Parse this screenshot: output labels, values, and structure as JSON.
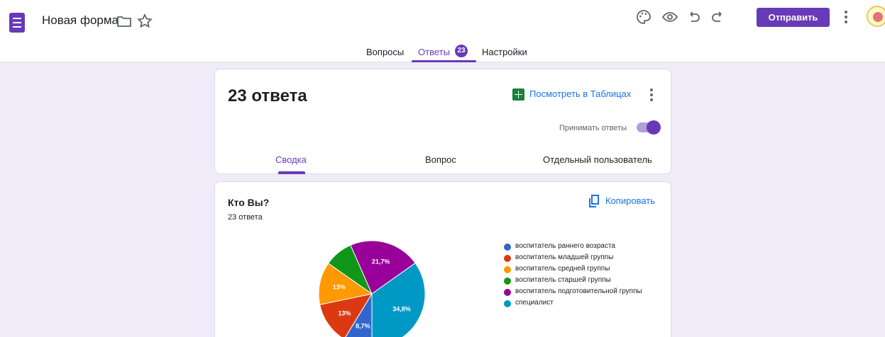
{
  "header": {
    "title": "Новая форма",
    "send_label": "Отправить"
  },
  "tabs": {
    "questions": "Вопросы",
    "responses": "Ответы",
    "responses_count": "23",
    "settings": "Настройки"
  },
  "summary_card": {
    "response_count": "23 ответа",
    "sheets_link": "Посмотреть в Таблицах",
    "accept_label": "Принимать ответы",
    "accepting_responses": true,
    "views": {
      "summary": "Сводка",
      "question": "Вопрос",
      "individual": "Отдельный пользователь"
    }
  },
  "question_card": {
    "title": "Кто Вы?",
    "response_count": "23 ответа",
    "copy_label": "Копировать"
  },
  "chart_data": {
    "type": "pie",
    "title": "",
    "slices": [
      {
        "label": "воспитатель раннего возраста",
        "value": 8.7,
        "display": "8,7%",
        "color": "#3366cc"
      },
      {
        "label": "воспитатель младшей группы",
        "value": 13.0,
        "display": "13%",
        "color": "#dc3912"
      },
      {
        "label": "воспитатель средней группы",
        "value": 13.0,
        "display": "13%",
        "color": "#ff9900"
      },
      {
        "label": "воспитатель старшей группы",
        "value": 8.7,
        "display": "",
        "color": "#109618"
      },
      {
        "label": "воспитатель подготовительной группы",
        "value": 21.7,
        "display": "21,7%",
        "color": "#990099"
      },
      {
        "label": "специалист",
        "value": 34.8,
        "display": "34,8%",
        "color": "#0099c6"
      }
    ],
    "legend_position": "right"
  },
  "colors": {
    "accent": "#673ab7",
    "link": "#1a73e8",
    "background": "#f0ebf8",
    "sheets": "#188038"
  },
  "icons": {
    "app": "google-forms-icon",
    "folder": "folder-icon",
    "star": "star-icon",
    "palette": "palette-icon",
    "preview": "eye-icon",
    "undo": "undo-icon",
    "redo": "redo-icon",
    "more": "more-vert-icon",
    "sheets": "sheets-icon",
    "copy": "copy-icon"
  }
}
